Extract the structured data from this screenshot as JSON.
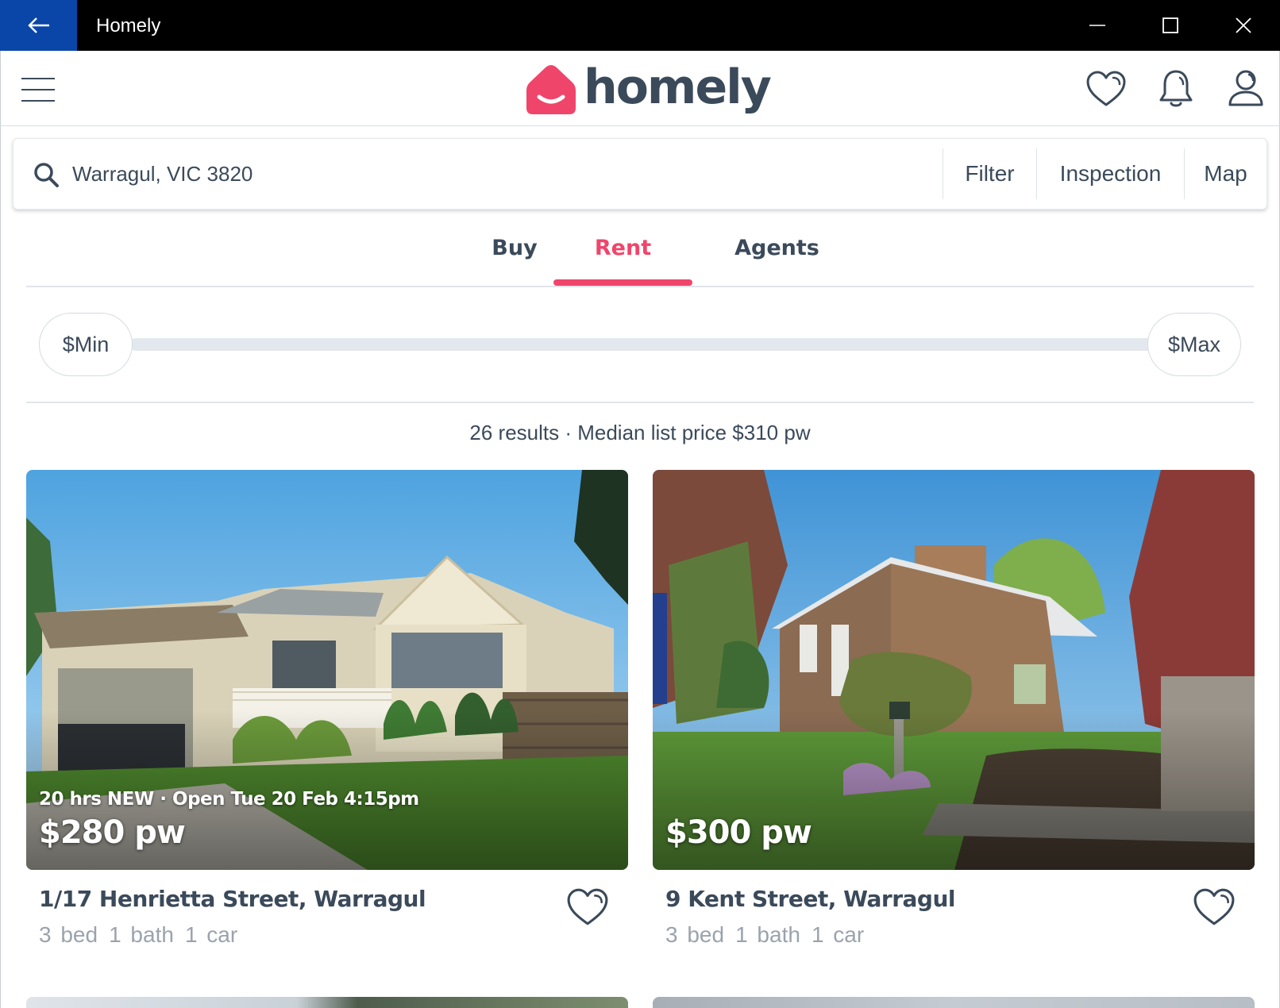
{
  "window": {
    "title": "Homely",
    "back_icon": "arrow-left-icon",
    "controls": [
      "minimize-icon",
      "maximize-icon",
      "close-icon"
    ]
  },
  "header": {
    "menu_icon": "hamburger-icon",
    "logo_text": "homely",
    "brand_color": "#f0456b",
    "text_color": "#3b4a5a",
    "icons": [
      "heart-icon",
      "bell-icon",
      "user-icon"
    ]
  },
  "search": {
    "value": "Warragul, VIC 3820",
    "filter_label": "Filter",
    "inspection_label": "Inspection",
    "map_label": "Map"
  },
  "tabs": [
    {
      "label": "Buy",
      "active": false
    },
    {
      "label": "Rent",
      "active": true
    },
    {
      "label": "Agents",
      "active": false
    }
  ],
  "price_range": {
    "min_label": "$Min",
    "max_label": "$Max"
  },
  "results": {
    "summary": "26 results · Median list price $310 pw"
  },
  "listings": [
    {
      "tag": "20 hrs NEW · Open Tue 20 Feb 4:15pm",
      "price": "$280 pw",
      "address": "1/17 Henrietta Street, Warragul",
      "bed": "3 bed",
      "bath": "1 bath",
      "car": "1 car"
    },
    {
      "tag": "",
      "price": "$300 pw",
      "address": "9 Kent Street, Warragul",
      "bed": "3 bed",
      "bath": "1 bath",
      "car": "1 car"
    }
  ]
}
